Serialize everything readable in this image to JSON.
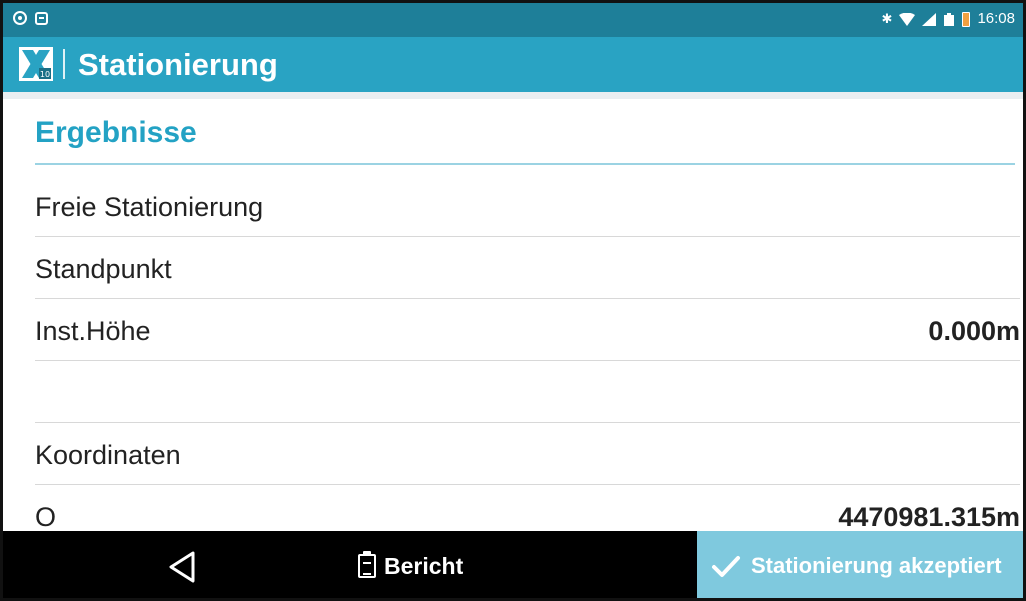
{
  "status_bar": {
    "time": "16:08",
    "icons": [
      "eye-icon",
      "app-notification-icon",
      "bluetooth-icon",
      "wifi-icon",
      "signal-icon",
      "battery-saver-icon",
      "battery-icon"
    ],
    "color": "#1e7f99"
  },
  "action_bar": {
    "title": "Stationierung",
    "color": "#29a3c3",
    "logo": "app-logo-icon"
  },
  "content": {
    "section_title": "Ergebnisse",
    "accent_color": "#23a2c4",
    "rows": [
      {
        "label": "Freie Stationierung",
        "value": ""
      },
      {
        "label": "Standpunkt",
        "value": ""
      },
      {
        "label": "Inst.Höhe",
        "value": "0.000m"
      },
      {
        "label": "",
        "value": ""
      },
      {
        "label": "Koordinaten",
        "value": ""
      },
      {
        "label": "O",
        "value": "4470981.315m"
      }
    ]
  },
  "bottom_bar": {
    "back_icon": "back-triangle-icon",
    "report_label": "Bericht",
    "report_icon": "clipboard-icon",
    "accept_label": "Stationierung akzeptiert",
    "accept_icon": "check-icon",
    "accept_color": "#7fc9de"
  }
}
